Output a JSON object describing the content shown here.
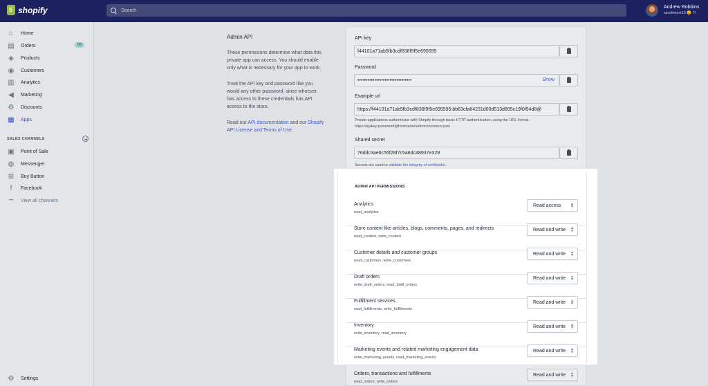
{
  "topbar": {
    "brand": "shopify",
    "search_placeholder": "Search",
    "user_name": "Andrew Robbins",
    "user_store": "wpslitetest10 😊 !!!"
  },
  "sidebar": {
    "items": [
      {
        "label": "Home",
        "icon": "home-icon",
        "glyph": "⌂"
      },
      {
        "label": "Orders",
        "icon": "orders-icon",
        "glyph": "▤",
        "badge": "55"
      },
      {
        "label": "Products",
        "icon": "tag-icon",
        "glyph": "◈"
      },
      {
        "label": "Customers",
        "icon": "person-icon",
        "glyph": "◉"
      },
      {
        "label": "Analytics",
        "icon": "bar-chart-icon",
        "glyph": "▥"
      },
      {
        "label": "Marketing",
        "icon": "megaphone-icon",
        "glyph": "◀"
      },
      {
        "label": "Discounts",
        "icon": "discount-icon",
        "glyph": "⚙"
      },
      {
        "label": "Apps",
        "icon": "apps-icon",
        "glyph": "▦"
      }
    ],
    "channels_heading": "SALES CHANNELS",
    "channels": [
      {
        "label": "Point of Sale",
        "icon": "store-icon",
        "glyph": "▣"
      },
      {
        "label": "Messenger",
        "icon": "messenger-icon",
        "glyph": "◍"
      },
      {
        "label": "Buy Button",
        "icon": "cart-icon",
        "glyph": "⊞"
      },
      {
        "label": "Facebook",
        "icon": "facebook-icon",
        "glyph": "f"
      },
      {
        "label": "View all channels",
        "icon": "more-icon",
        "glyph": "•••"
      }
    ],
    "settings": {
      "label": "Settings",
      "icon": "gear-icon",
      "glyph": "⚙"
    }
  },
  "main": {
    "title": "Admin API",
    "desc1": "These permissions determine what data this private app can access. You should enable only what is necessary for your app to work.",
    "desc2": "Treat the API key and password like you would any other password, since whoever has access to these credentials has API access to the store.",
    "desc3_prefix": "Read our ",
    "desc3_link1": "API documentation",
    "desc3_mid": " and our ",
    "desc3_link2": "Shopify API License and Terms of Use",
    "desc3_suffix": "."
  },
  "credentials": {
    "api_key_label": "API key",
    "api_key": "f44101a71ab5fb3cdf838f9f5e695595",
    "password_label": "Password",
    "password": "••••••••••••••••••••••••••••••••",
    "show_label": "Show",
    "example_url_label": "Example url",
    "example_url": "https://f44101a71ab5fb3cdf838f9f5e695595:bb63cfa64231d00d513d895c19f0f54d8@",
    "example_help1": "Private applications authenticate with Shopify through basic HTTP authentication, using the URL format",
    "example_help2": "https://apikey:password@hostname/admin/resource.json",
    "shared_secret_label": "Shared secret",
    "shared_secret": "76ddc3ae6c55f28f7c5a6dc48937e329",
    "secret_help_prefix": "Secrets are used to ",
    "secret_help_link": "validate the integrity of webhooks",
    "secret_help_suffix": "."
  },
  "permissions": {
    "heading": "ADMIN API PERMISSIONS",
    "rows": [
      {
        "name": "Analytics",
        "scope": "read_analytics",
        "value": "Read access"
      },
      {
        "name": "Store content like articles, blogs, comments, pages, and redirects",
        "scope": "read_content, write_content",
        "value": "Read and write"
      },
      {
        "name": "Customer details and customer groups",
        "scope": "read_customers, write_customers",
        "value": "Read and write"
      },
      {
        "name": "Draft orders",
        "scope": "write_draft_orders, read_draft_orders",
        "value": "Read and write"
      },
      {
        "name": "Fulfillment services",
        "scope": "read_fulfillments, write_fulfillments",
        "value": "Read and write"
      },
      {
        "name": "Inventory",
        "scope": "write_inventory, read_inventory",
        "value": "Read and write"
      },
      {
        "name": "Marketing events and related marketing engagement data",
        "scope": "write_marketing_events, read_marketing_events",
        "value": "Read and write"
      },
      {
        "name": "Orders, transactions and fulfillments",
        "scope": "read_orders, write_orders",
        "value": "Read and write"
      }
    ]
  },
  "colors": {
    "topbar": "#1c2260",
    "accent": "#3a57d6",
    "highlight": "#ffffff"
  }
}
